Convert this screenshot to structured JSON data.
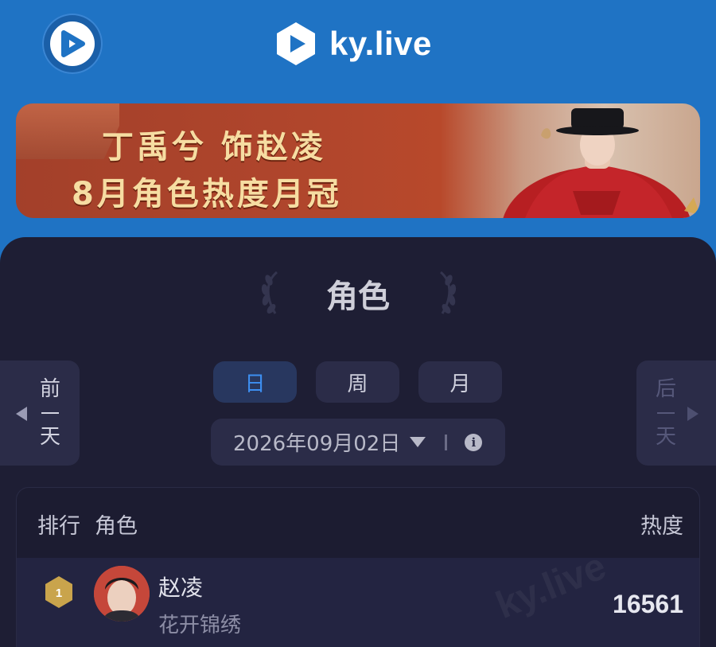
{
  "header": {
    "brand_text": "ky.live",
    "brand_color": "#1f73c4"
  },
  "banner": {
    "line1": "丁禹兮 饰赵凌",
    "line2": "8月角色热度月冠"
  },
  "section": {
    "title": "角色"
  },
  "nav": {
    "prev_label": [
      "前",
      "天"
    ],
    "next_label": [
      "后",
      "天"
    ]
  },
  "tabs": [
    {
      "label": "日",
      "active": true
    },
    {
      "label": "周",
      "active": false
    },
    {
      "label": "月",
      "active": false
    }
  ],
  "date_picker": {
    "value": "2026年09月02日"
  },
  "table": {
    "headers": {
      "rank": "排行",
      "role": "角色",
      "heat": "热度"
    },
    "rows": [
      {
        "rank": "1",
        "name": "赵凌",
        "drama": "花开锦绣",
        "heat": "16561"
      }
    ]
  },
  "colors": {
    "accent_blue": "#3d8ff2",
    "card_bg": "#1e1e34",
    "gold": "#c9a44c"
  }
}
